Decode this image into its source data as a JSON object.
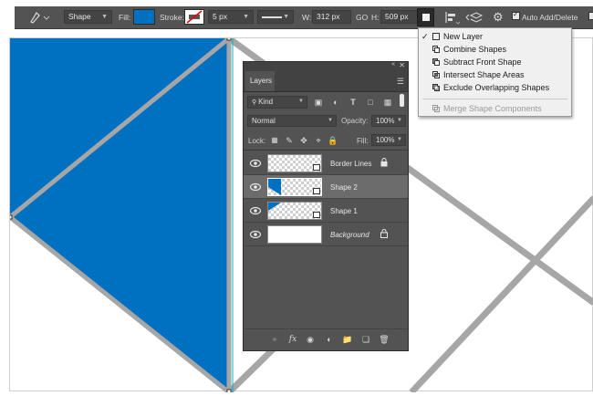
{
  "options_bar": {
    "tool_icon": "pen-tool-icon",
    "mode": "Shape",
    "fill_label": "Fill:",
    "fill_color": "#0070c0",
    "stroke_label": "Stroke:",
    "stroke_width": "5 px",
    "w_label": "W:",
    "w_value": "312 px",
    "link_label": "GO",
    "h_label": "H:",
    "h_value": "509 px",
    "auto_add_delete_label": "Auto Add/Delete",
    "auto_add_delete_checked": true
  },
  "path_ops_menu": {
    "items": [
      {
        "label": "New Layer",
        "checked": true,
        "enabled": true
      },
      {
        "label": "Combine Shapes",
        "checked": false,
        "enabled": true
      },
      {
        "label": "Subtract Front Shape",
        "checked": false,
        "enabled": true
      },
      {
        "label": "Intersect Shape Areas",
        "checked": false,
        "enabled": true
      },
      {
        "label": "Exclude Overlapping Shapes",
        "checked": false,
        "enabled": true
      },
      {
        "label": "Merge Shape Components",
        "checked": false,
        "enabled": false
      }
    ]
  },
  "layers_panel": {
    "tab_label": "Layers",
    "filter_kind": "Kind",
    "blend_mode": "Normal",
    "opacity_label": "Opacity:",
    "opacity_value": "100%",
    "lock_label": "Lock:",
    "fill_label": "Fill:",
    "fill_value": "100%",
    "layers": [
      {
        "name": "Border Lines",
        "locked": true,
        "selected": false,
        "italic": false
      },
      {
        "name": "Shape 2",
        "locked": false,
        "selected": true,
        "italic": false
      },
      {
        "name": "Shape 1",
        "locked": false,
        "selected": false,
        "italic": false
      },
      {
        "name": "Background",
        "locked": true,
        "selected": false,
        "italic": true
      }
    ]
  },
  "colors": {
    "shape_blue": "#0070c0",
    "border_gray": "#a6a6a6",
    "guide_cyan": "#00b4c8"
  }
}
